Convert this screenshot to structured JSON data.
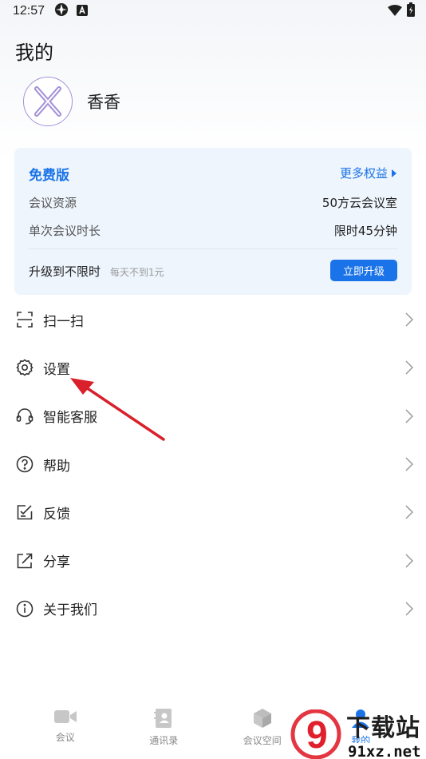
{
  "status_bar": {
    "time": "12:57",
    "icons": [
      "sync-icon",
      "a-badge-icon",
      "wifi-icon",
      "battery-icon"
    ]
  },
  "header": {
    "title": "我的"
  },
  "profile": {
    "name": "香香",
    "avatar_letter": "X"
  },
  "plan_card": {
    "plan_name": "免费版",
    "more_benefits": "更多权益",
    "rows": [
      {
        "label": "会议资源",
        "value": "50方云会议室"
      },
      {
        "label": "单次会议时长",
        "value": "限时45分钟"
      }
    ],
    "upgrade_text": "升级到不限时",
    "upgrade_sub": "每天不到1元",
    "upgrade_button": "立即升级"
  },
  "menu": {
    "items": [
      {
        "label": "扫一扫",
        "icon": "scan-icon"
      },
      {
        "label": "设置",
        "icon": "gear-icon"
      },
      {
        "label": "智能客服",
        "icon": "headset-icon"
      },
      {
        "label": "帮助",
        "icon": "help-icon"
      },
      {
        "label": "反馈",
        "icon": "feedback-icon"
      },
      {
        "label": "分享",
        "icon": "share-icon"
      },
      {
        "label": "关于我们",
        "icon": "info-icon"
      }
    ]
  },
  "tabbar": {
    "tabs": [
      {
        "label": "会议",
        "icon": "video-camera-icon"
      },
      {
        "label": "通讯录",
        "icon": "contacts-icon"
      },
      {
        "label": "会议空间",
        "icon": "cube-icon"
      },
      {
        "label": "我的",
        "icon": "person-icon"
      }
    ]
  },
  "watermark": {
    "top": "下载站",
    "bottom": "91xz.net",
    "logo_digit": "9"
  },
  "colors": {
    "accent": "#1a73e8",
    "annotation_arrow": "#d9202b",
    "avatar_ring": "#a491d8"
  }
}
